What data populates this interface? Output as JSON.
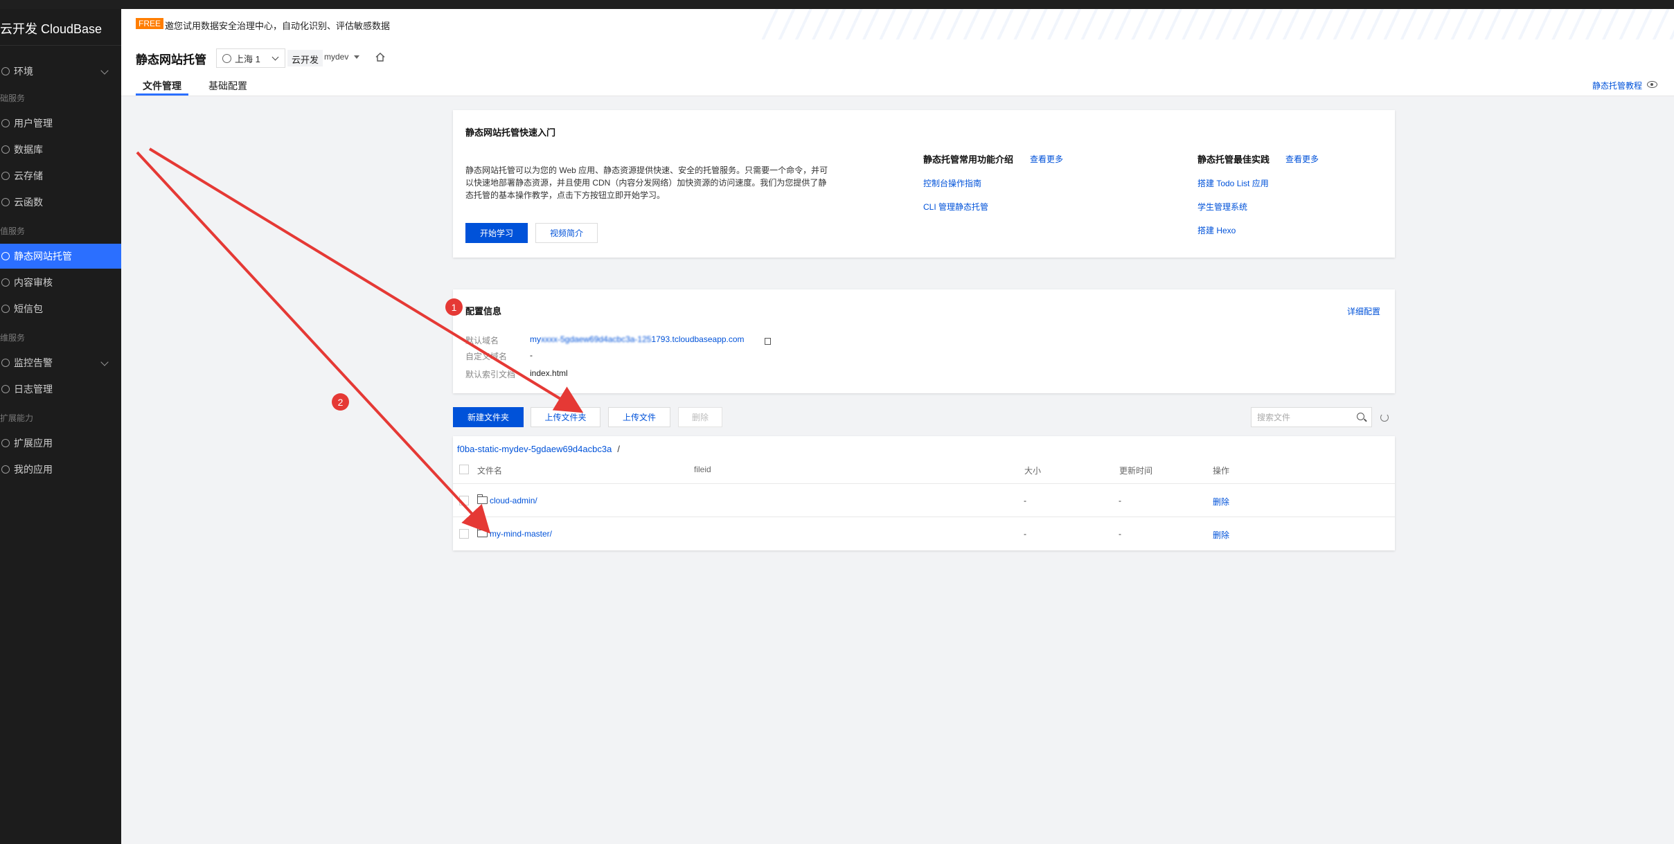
{
  "sidebar": {
    "brand": "云开发 CloudBase",
    "items": [
      {
        "label": "环境",
        "group": null
      },
      {
        "label": "用户管理"
      },
      {
        "label": "数据库"
      },
      {
        "label": "云存储"
      },
      {
        "label": "云函数"
      },
      {
        "label": "静态网站托管",
        "active": true
      },
      {
        "label": "内容审核"
      },
      {
        "label": "短信包"
      },
      {
        "label": "监控告警"
      },
      {
        "label": "日志管理"
      },
      {
        "label": "扩展应用"
      },
      {
        "label": "我的应用"
      }
    ],
    "groups": [
      "础服务",
      "值服务",
      "维服务",
      "扩展能力"
    ]
  },
  "banner": {
    "badge": "FREE",
    "text": "邀您试用数据安全治理中心，自动化识别、评估敏感数据"
  },
  "header": {
    "title": "静态网站托管",
    "region": "上海 1",
    "env_type": "云开发",
    "env_name": "mydev",
    "tabs": [
      "文件管理",
      "基础配置"
    ],
    "tutorial_link": "静态托管教程"
  },
  "quickstart": {
    "title": "静态网站托管快速入门",
    "description": "静态网站托管可以为您的 Web 应用、静态资源提供快速、安全的托管服务。只需要一个命令，并可以快速地部署静态资源，并且使用 CDN（内容分发网络）加快资源的访问速度。我们为您提供了静态托管的基本操作教学，点击下方按钮立即开始学习。",
    "start_button": "开始学习",
    "video_button": "视频简介",
    "features_title": "静态托管常用功能介绍",
    "features_more": "查看更多",
    "features": [
      "控制台操作指南",
      "CLI 管理静态托管"
    ],
    "practices_title": "静态托管最佳实践",
    "practices_more": "查看更多",
    "practices": [
      "搭建 Todo List 应用",
      "学生管理系统",
      "搭建 Hexo"
    ]
  },
  "config": {
    "title": "配置信息",
    "detail_link": "详细配置",
    "rows": [
      {
        "label": "默认域名",
        "value_prefix": "my",
        "value_suffix": "1793.tcloudbaseapp.com"
      },
      {
        "label": "自定义域名",
        "value": "-"
      },
      {
        "label": "默认索引文档",
        "value": "index.html"
      }
    ]
  },
  "toolbar": {
    "new_folder": "新建文件夹",
    "upload_folder": "上传文件夹",
    "upload_file": "上传文件",
    "delete": "删除",
    "search_placeholder": "搜索文件"
  },
  "files": {
    "breadcrumb": "f0ba-static-mydev-5gdaew69d4acbc3a",
    "breadcrumb_sep": "/",
    "columns": [
      "文件名",
      "fileid",
      "大小",
      "更新时间",
      "操作"
    ],
    "rows": [
      {
        "name": "cloud-admin/",
        "size": "-",
        "updated": "-",
        "action": "删除"
      },
      {
        "name": "my-mind-master/",
        "size": "-",
        "updated": "-",
        "action": "删除"
      }
    ]
  },
  "annotations": {
    "badges": [
      "1",
      "2"
    ],
    "color": "#e53935"
  }
}
